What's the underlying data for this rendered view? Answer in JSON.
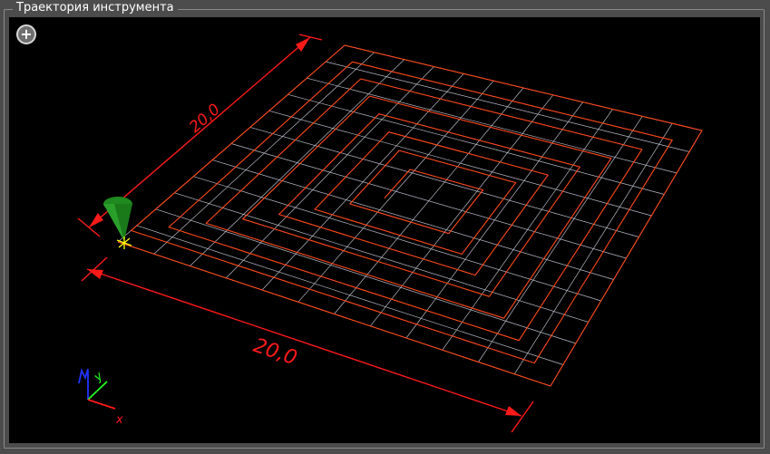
{
  "panel": {
    "title": "Траектория инструмента"
  },
  "viewport": {
    "zoom_button_label": "+",
    "dimension_x_label": "20,0",
    "dimension_y_label": "20,0",
    "axis_x_label": "x",
    "axis_y_label": "y",
    "grid_divisions": 12,
    "spiral_loops": 8
  },
  "colors": {
    "background": "#000000",
    "panel": "#4c4c4c",
    "grid": "#b8bcc8",
    "toolpath": "#ff4a1a",
    "dimension": "#ff1a1a",
    "tool": "#1f8a1f",
    "tool_marker": "#ffff00",
    "axis_x": "#ff1a1a",
    "axis_y": "#22ff22",
    "axis_z": "#2233ff"
  },
  "icons": {
    "zoom": "plus-circle-icon",
    "tool": "cone-tool-icon",
    "axes": "xyz-axes-icon"
  }
}
